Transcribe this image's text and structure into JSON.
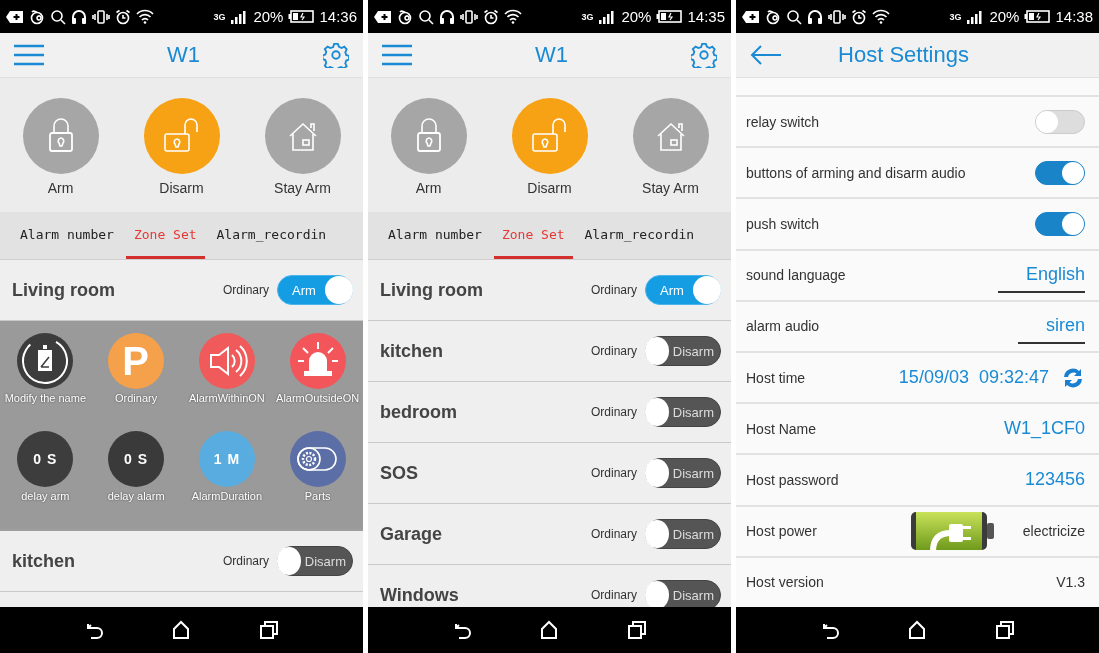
{
  "phones": [
    {
      "kind": "zones",
      "status": {
        "network": "3G",
        "battery": "20%",
        "time": "14:36"
      },
      "title": "W1",
      "modes": [
        {
          "label": "Arm",
          "selected": false
        },
        {
          "label": "Disarm",
          "selected": true
        },
        {
          "label": "Stay Arm",
          "selected": false
        }
      ],
      "tabs": [
        {
          "label": "Alarm number",
          "selected": false
        },
        {
          "label": "Zone Set",
          "selected": true
        },
        {
          "label": "Alarm_recordin",
          "selected": false
        }
      ],
      "zones": [
        {
          "name": "Living room",
          "type": "Ordinary",
          "armed": true,
          "toggle": "Arm",
          "options": [
            {
              "kind": "stopwatch",
              "color": "#3c3c3c",
              "label": "Modify the name"
            },
            {
              "kind": "glyph",
              "glyph": "P",
              "color": "#f5a04a",
              "label": "Ordinary"
            },
            {
              "kind": "speaker",
              "color": "#f05a5a",
              "label": "AlarmWithinON"
            },
            {
              "kind": "siren",
              "color": "#f2565a",
              "label": "AlarmOutsideON"
            },
            {
              "kind": "value",
              "value": "0 S",
              "color": "#3d3d3d",
              "label": "delay arm"
            },
            {
              "kind": "value",
              "value": "0 S",
              "color": "#3a3a3a",
              "label": "delay alarm"
            },
            {
              "kind": "value",
              "value": "1 M",
              "color": "#58acdf",
              "label": "AlarmDuration"
            },
            {
              "kind": "parts",
              "color": "#5b6ea6",
              "label": "Parts"
            }
          ]
        },
        {
          "name": "kitchen",
          "type": "Ordinary",
          "armed": false,
          "toggle": "Disarm"
        }
      ]
    },
    {
      "kind": "zones",
      "status": {
        "network": "3G",
        "battery": "20%",
        "time": "14:35"
      },
      "title": "W1",
      "modes": [
        {
          "label": "Arm",
          "selected": false
        },
        {
          "label": "Disarm",
          "selected": true
        },
        {
          "label": "Stay Arm",
          "selected": false
        }
      ],
      "tabs": [
        {
          "label": "Alarm number",
          "selected": false
        },
        {
          "label": "Zone Set",
          "selected": true
        },
        {
          "label": "Alarm_recordin",
          "selected": false
        }
      ],
      "zones": [
        {
          "name": "Living room",
          "type": "Ordinary",
          "armed": true,
          "toggle": "Arm"
        },
        {
          "name": "kitchen",
          "type": "Ordinary",
          "armed": false,
          "toggle": "Disarm"
        },
        {
          "name": "bedroom",
          "type": "Ordinary",
          "armed": false,
          "toggle": "Disarm"
        },
        {
          "name": "SOS",
          "type": "Ordinary",
          "armed": false,
          "toggle": "Disarm"
        },
        {
          "name": "Garage",
          "type": "Ordinary",
          "armed": false,
          "toggle": "Disarm"
        },
        {
          "name": "Windows",
          "type": "Ordinary",
          "armed": false,
          "toggle": "Disarm"
        }
      ]
    },
    {
      "kind": "settings",
      "status": {
        "network": "3G",
        "battery": "20%",
        "time": "14:38"
      },
      "title": "Host Settings",
      "settings": [
        {
          "kind": "switch",
          "label": "relay switch",
          "on": false
        },
        {
          "kind": "switch",
          "label": "buttons of arming and disarm audio",
          "on": true
        },
        {
          "kind": "switch",
          "label": "push switch",
          "on": true
        },
        {
          "kind": "select",
          "label": "sound language",
          "value": "English"
        },
        {
          "kind": "select",
          "label": "alarm audio",
          "value": "siren"
        },
        {
          "kind": "time",
          "label": "Host time",
          "value": "15/09/03  09:32:47"
        },
        {
          "kind": "value",
          "label": "Host Name",
          "value": "W1_1CF0"
        },
        {
          "kind": "value",
          "label": "Host password",
          "value": "123456"
        },
        {
          "kind": "power",
          "label": "Host power",
          "value": "electricize"
        },
        {
          "kind": "text",
          "label": "Host version",
          "value": "V1.3"
        }
      ]
    }
  ]
}
